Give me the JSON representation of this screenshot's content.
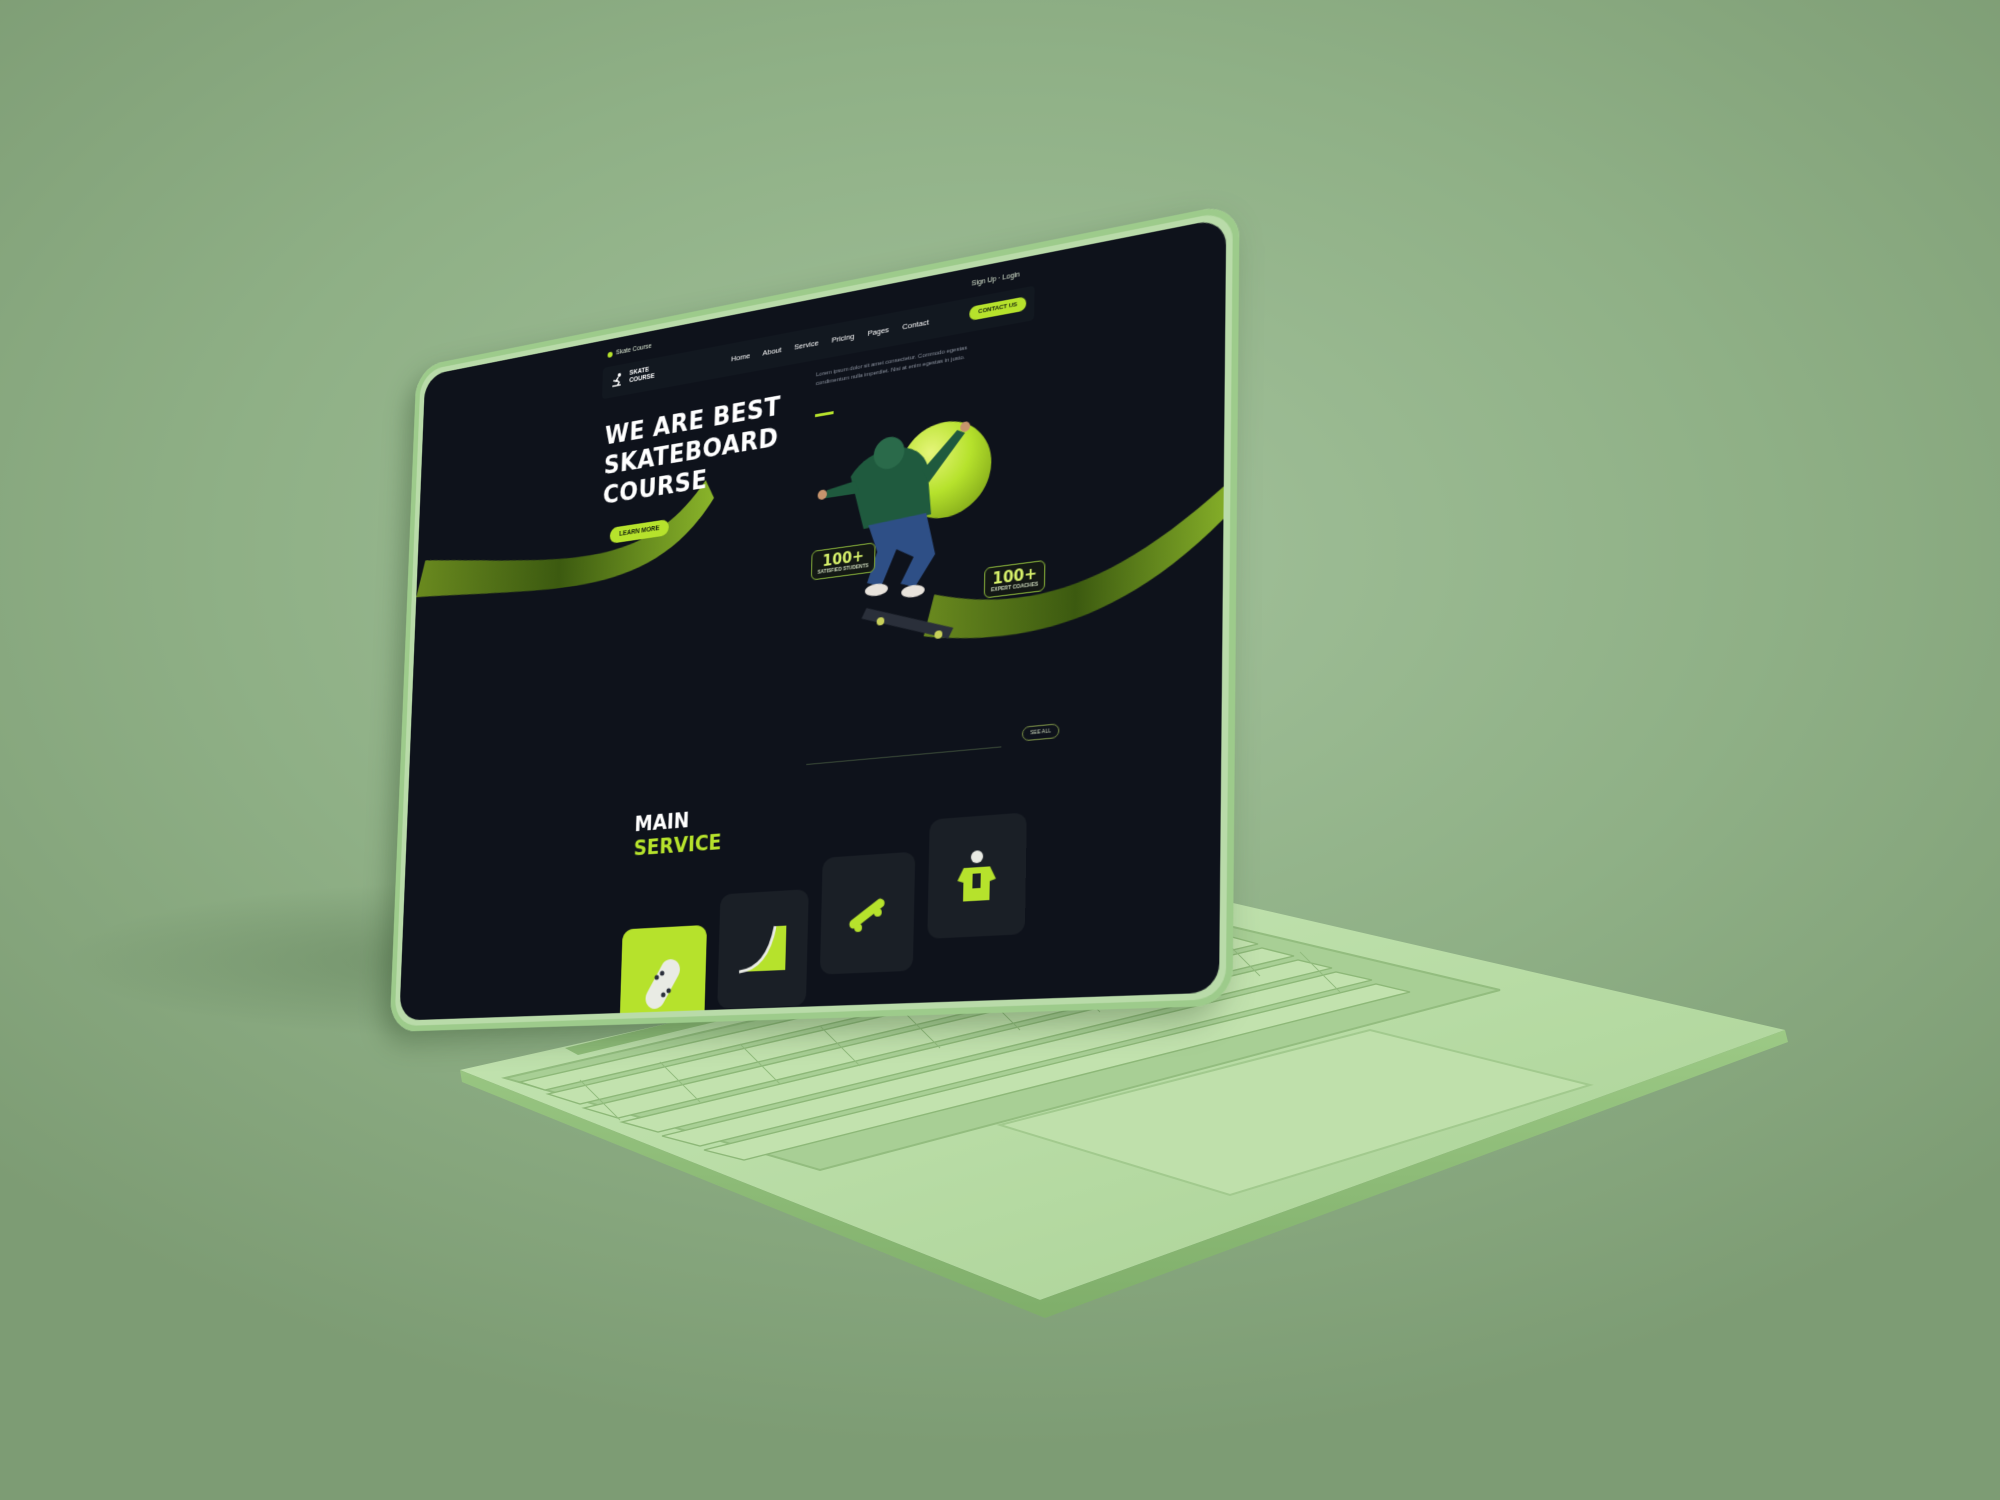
{
  "topbar": {
    "left_text": "Skate Course",
    "right_text": "Sign Up · Login"
  },
  "brand": {
    "logo_line1": "SKATE",
    "logo_line2": "COURSE"
  },
  "nav": {
    "items": [
      "Home",
      "About",
      "Service",
      "Pricing",
      "Pages",
      "Contact"
    ],
    "cta_label": "CONTACT US"
  },
  "hero": {
    "title_lines": [
      "WE ARE BEST",
      "SKATEBOARD",
      "COURSE"
    ],
    "button_label": "LEARN MORE",
    "description": "Lorem ipsum dolor sit amet consectetur. Commodo egestas condimentum nulla imperdiet. Nisi at enim egestas in justo.",
    "stats": [
      {
        "value": "100+",
        "label": "SATISFIED STUDENTS"
      },
      {
        "value": "100+",
        "label": "EXPERT COACHES"
      }
    ]
  },
  "section": {
    "view_all_label": "SEE ALL",
    "title_line1": "MAIN",
    "title_line2": "SERVICE"
  },
  "services": [
    {
      "icon": "skateboard-top-icon",
      "active": true
    },
    {
      "icon": "ramp-icon",
      "active": false
    },
    {
      "icon": "skateboard-side-icon",
      "active": false
    },
    {
      "icon": "skater-jacket-icon",
      "active": false
    }
  ],
  "colors": {
    "accent": "#b6e22c",
    "screen_bg": "#0e121b",
    "laptop_body": "#b9dba9",
    "background": "#8fb086"
  }
}
